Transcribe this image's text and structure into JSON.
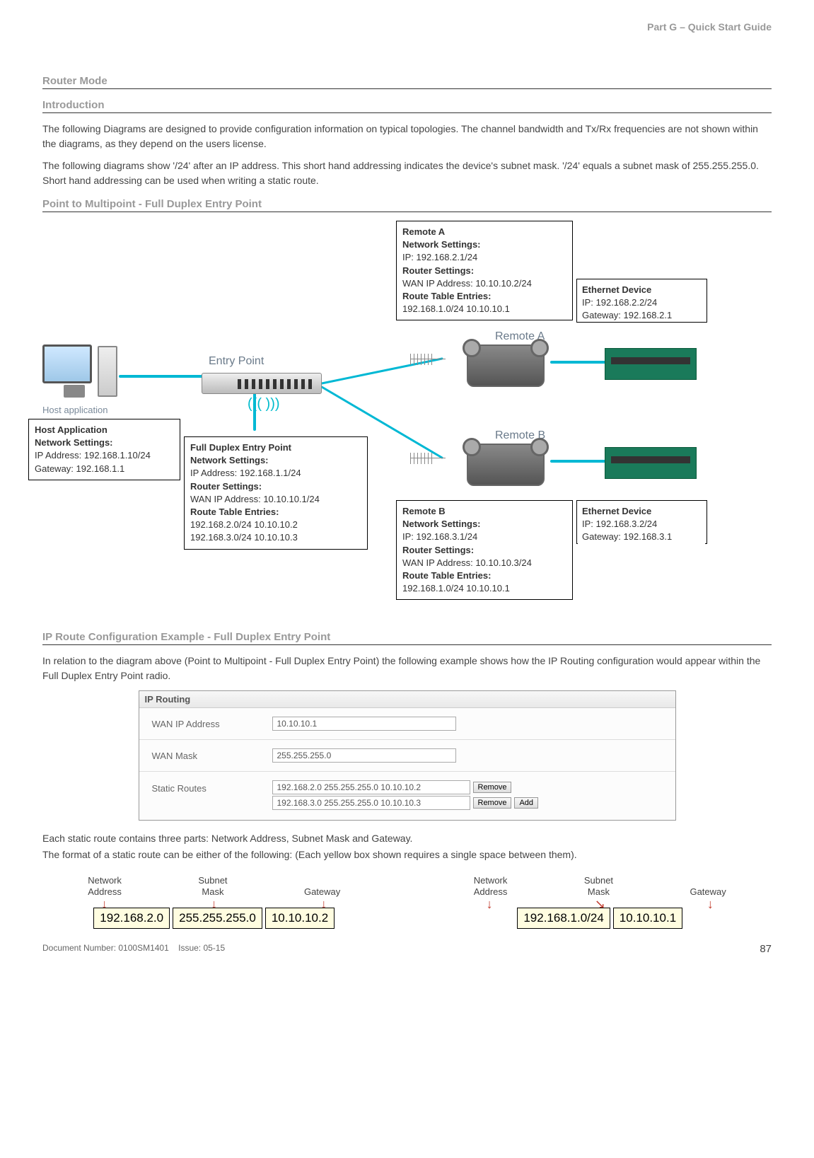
{
  "header": {
    "partLabel": "Part G – Quick Start Guide"
  },
  "sections": {
    "routerMode": "Router Mode",
    "introduction": "Introduction",
    "p2mp": "Point to Multipoint - Full Duplex Entry Point",
    "ipRouteExample": "IP Route Configuration Example - Full Duplex Entry Point"
  },
  "intro": {
    "p1": "The following Diagrams are designed to provide configuration information on typical topologies. The channel bandwidth and Tx/Rx frequencies are not shown within the diagrams, as they depend on the users license.",
    "p2": "The following diagrams show '/24' after an IP address. This short hand addressing indicates the device's subnet mask. '/24' equals a subnet mask of 255.255.255.0. Short hand addressing can be used when writing a static route."
  },
  "diagram": {
    "hostLabel": "Host application",
    "entryPointLabel": "Entry Point",
    "remoteALabel": "Remote A",
    "remoteBLabel": "Remote B",
    "hostApp": {
      "title": "Host Application",
      "netHdr": "Network Settings:",
      "ip": "IP Address: 192.168.1.10/24",
      "gw": "Gateway: 192.168.1.1"
    },
    "entryPoint": {
      "title": "Full Duplex Entry Point",
      "netHdr": "Network Settings:",
      "ip": "IP Address: 192.168.1.1/24",
      "routerHdr": "Router Settings:",
      "wan": "WAN IP Address: 10.10.10.1/24",
      "rteHdr": "Route Table Entries:",
      "rte1": "192.168.2.0/24 10.10.10.2",
      "rte2": "192.168.3.0/24 10.10.10.3"
    },
    "remoteA": {
      "title": "Remote A",
      "netHdr": "Network Settings:",
      "ip": "IP: 192.168.2.1/24",
      "routerHdr": "Router Settings:",
      "wan": "WAN IP Address: 10.10.10.2/24",
      "rteHdr": "Route Table Entries:",
      "rte": "192.168.1.0/24 10.10.10.1"
    },
    "remoteB": {
      "title": "Remote B",
      "netHdr": "Network Settings:",
      "ip": "IP: 192.168.3.1/24",
      "routerHdr": "Router Settings:",
      "wan": "WAN IP Address: 10.10.10.3/24",
      "rteHdr": "Route Table Entries:",
      "rte": "192.168.1.0/24 10.10.10.1"
    },
    "ethA": {
      "title": "Ethernet Device",
      "ip": "IP: 192.168.2.2/24",
      "gw": "Gateway: 192.168.2.1"
    },
    "ethB": {
      "title": "Ethernet Device",
      "ip": "IP: 192.168.3.2/24",
      "gw": "Gateway: 192.168.3.1"
    }
  },
  "ipRoute": {
    "intro": "In relation to the diagram above (Point to Multipoint - Full Duplex Entry Point) the following example shows how the IP Routing configuration would appear within the Full Duplex Entry Point radio.",
    "panelTitle": "IP Routing",
    "wanIpLabel": "WAN IP Address",
    "wanIpValue": "10.10.10.1",
    "wanMaskLabel": "WAN Mask",
    "wanMaskValue": "255.255.255.0",
    "staticRoutesLabel": "Static Routes",
    "route1": "192.168.2.0 255.255.255.0 10.10.10.2",
    "route2": "192.168.3.0 255.255.255.0 10.10.10.3",
    "removeBtn": "Remove",
    "addBtn": "Add",
    "note1": "Each static route contains three parts: Network Address, Subnet Mask and Gateway.",
    "note2": "The format of a static route can be either of the following: (Each yellow box shown requires a single space between them)."
  },
  "staticRouteFmt": {
    "labels": {
      "net": "Network",
      "addr": "Address",
      "sub": "Subnet",
      "mask": "Mask",
      "gw": "Gateway"
    },
    "ex1": {
      "a": "192.168.2.0",
      "b": "255.255.255.0",
      "c": "10.10.10.2"
    },
    "ex2": {
      "a": "192.168.1.0/24",
      "b": "10.10.10.1"
    }
  },
  "footer": {
    "doc": "Document Number: 0100SM1401",
    "issue": "Issue: 05-15",
    "page": "87"
  }
}
